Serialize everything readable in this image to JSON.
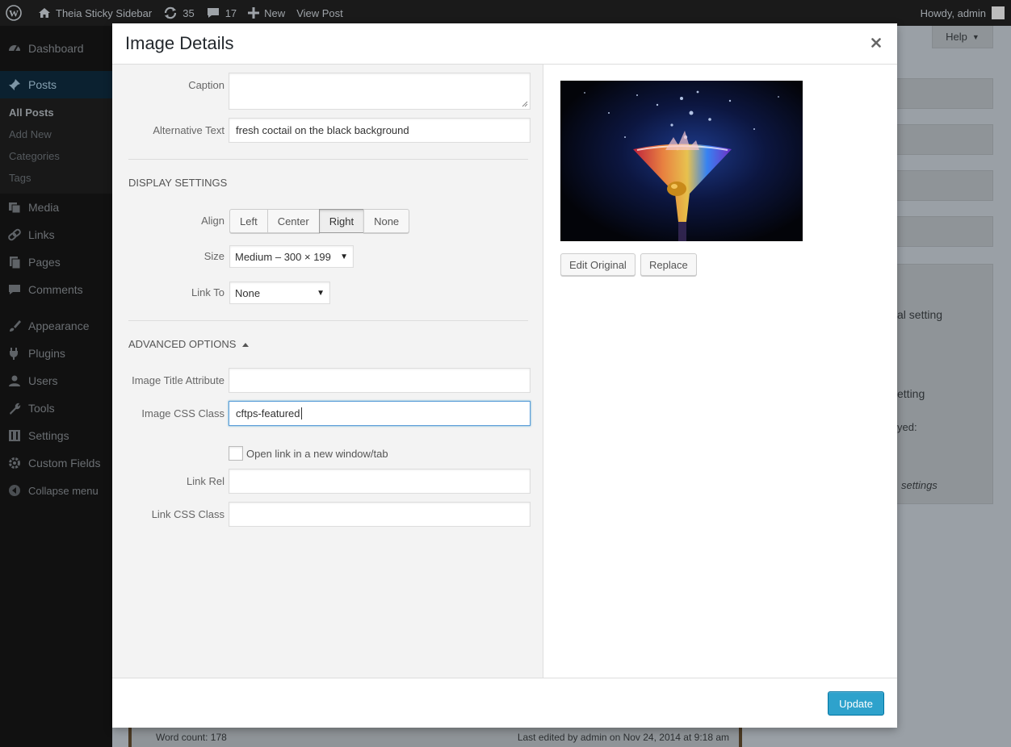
{
  "adminbar": {
    "site_name": "Theia Sticky Sidebar",
    "updates_count": "35",
    "comments_count": "17",
    "new_label": "New",
    "view_post_label": "View Post",
    "howdy": "Howdy, admin"
  },
  "sidebar": {
    "items": [
      {
        "label": "Dashboard",
        "icon": "dashboard-icon"
      },
      {
        "label": "Posts",
        "icon": "pin-icon"
      },
      {
        "label": "Media",
        "icon": "media-icon"
      },
      {
        "label": "Links",
        "icon": "link-icon"
      },
      {
        "label": "Pages",
        "icon": "pages-icon"
      },
      {
        "label": "Comments",
        "icon": "comment-icon"
      },
      {
        "label": "Appearance",
        "icon": "brush-icon"
      },
      {
        "label": "Plugins",
        "icon": "plugin-icon"
      },
      {
        "label": "Users",
        "icon": "users-icon"
      },
      {
        "label": "Tools",
        "icon": "wrench-icon"
      },
      {
        "label": "Settings",
        "icon": "settings-icon"
      },
      {
        "label": "Custom Fields",
        "icon": "gear-icon"
      }
    ],
    "posts_submenu": [
      "All Posts",
      "Add New",
      "Categories",
      "Tags"
    ],
    "collapse_label": "Collapse menu"
  },
  "background": {
    "help_label": "Help",
    "setting_text_1": "al setting",
    "setting_text_2": "etting",
    "setting_text_3": "yed:",
    "setting_text_4": "settings",
    "word_count": "Word count: 178",
    "last_edited": "Last edited by admin on Nov 24, 2014 at 9:18 am"
  },
  "modal": {
    "title": "Image Details",
    "caption_label": "Caption",
    "caption_value": "",
    "alt_label": "Alternative Text",
    "alt_value": "fresh coctail on the black background",
    "display_settings_title": "DISPLAY SETTINGS",
    "align_label": "Align",
    "align_options": [
      "Left",
      "Center",
      "Right",
      "None"
    ],
    "align_selected": "Right",
    "size_label": "Size",
    "size_value": "Medium – 300 × 199",
    "link_to_label": "Link To",
    "link_to_value": "None",
    "advanced_title": "ADVANCED OPTIONS",
    "title_attr_label": "Image Title Attribute",
    "title_attr_value": "",
    "css_class_label": "Image CSS Class",
    "css_class_value": "cftps-featured",
    "new_window_label": "Open link in a new window/tab",
    "link_rel_label": "Link Rel",
    "link_rel_value": "",
    "link_css_label": "Link CSS Class",
    "link_css_value": "",
    "edit_original_label": "Edit Original",
    "replace_label": "Replace",
    "update_label": "Update"
  },
  "colors": {
    "primary_button": "#2ea2cc",
    "admin_bar": "#1a1a1a",
    "sidebar": "#111111"
  }
}
